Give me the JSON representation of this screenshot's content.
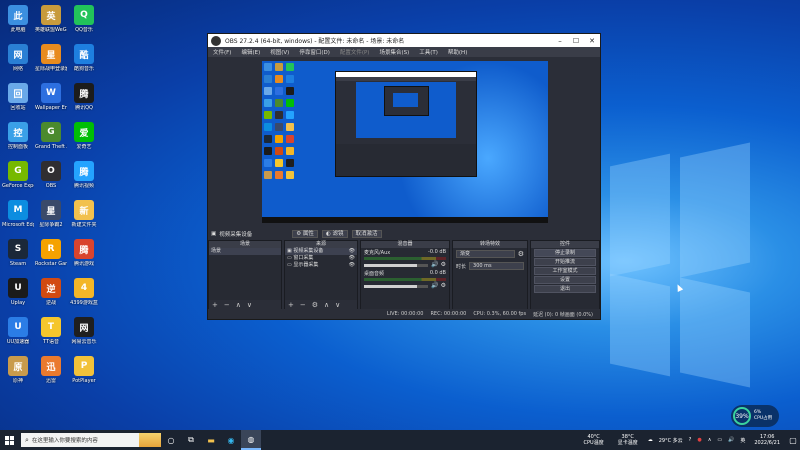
{
  "desktop": {
    "icons": [
      {
        "label": "此电脑",
        "color": "#3b8fe0",
        "icon": "computer-icon"
      },
      {
        "label": "英雄联盟WeGame版",
        "color": "#c89b3c",
        "icon": "game-icon"
      },
      {
        "label": "QQ音乐",
        "color": "#22c35a",
        "icon": "music-icon"
      },
      {
        "label": "网络",
        "color": "#2a7fd4",
        "icon": "network-icon"
      },
      {
        "label": "星际战甲登录器",
        "color": "#e88b1e",
        "icon": "game-icon"
      },
      {
        "label": "酷狗音乐",
        "color": "#1e7fe0",
        "icon": "music-icon"
      },
      {
        "label": "回收站",
        "color": "#6aa9e9",
        "icon": "recycle-bin-icon"
      },
      {
        "label": "Wallpaper Engine",
        "color": "#2d6fe0",
        "icon": "wallpaper-icon"
      },
      {
        "label": "腾讯QQ",
        "color": "#1c1c1c",
        "icon": "qq-icon"
      },
      {
        "label": "控制面板",
        "color": "#3aa0e8",
        "icon": "control-panel-icon"
      },
      {
        "label": "Grand Theft Auto V",
        "color": "#4b8a2e",
        "icon": "game-icon"
      },
      {
        "label": "爱奇艺",
        "color": "#00be06",
        "icon": "video-icon"
      },
      {
        "label": "GeForce Experience",
        "color": "#76b900",
        "icon": "nvidia-icon"
      },
      {
        "label": "OBS",
        "color": "#302e31",
        "icon": "obs-icon"
      },
      {
        "label": "腾讯视频",
        "color": "#24a3ff",
        "icon": "video-icon"
      },
      {
        "label": "Microsoft Edge",
        "color": "#0c8de0",
        "icon": "edge-icon"
      },
      {
        "label": "星际争霸2",
        "color": "#3a4a6a",
        "icon": "game-icon"
      },
      {
        "label": "新建文件夹",
        "color": "#f2c14e",
        "icon": "folder-icon"
      },
      {
        "label": "Steam",
        "color": "#1b2838",
        "icon": "steam-icon"
      },
      {
        "label": "Rockstar Games",
        "color": "#f5a200",
        "icon": "rockstar-icon"
      },
      {
        "label": "腾讯游戏",
        "color": "#d9442e",
        "icon": "game-icon"
      },
      {
        "label": "Uplay",
        "color": "#1b1b1b",
        "icon": "uplay-icon"
      },
      {
        "label": "逆战",
        "color": "#d24a12",
        "icon": "game-icon"
      },
      {
        "label": "4399游戏盒",
        "color": "#f3b628",
        "icon": "game-icon"
      },
      {
        "label": "UU加速器",
        "color": "#2b7de6",
        "icon": "accelerator-icon"
      },
      {
        "label": "TT语音",
        "color": "#f5c62c",
        "icon": "voice-icon"
      },
      {
        "label": "网易云音乐",
        "color": "#1f1f1f",
        "icon": "music-icon"
      },
      {
        "label": "原神",
        "color": "#c99b4c",
        "icon": "game-icon"
      },
      {
        "label": "迅雷",
        "color": "#ea7a2e",
        "icon": "download-icon"
      },
      {
        "label": "PotPlayer",
        "color": "#f2c23a",
        "icon": "player-icon"
      }
    ]
  },
  "obs": {
    "title": "OBS 27.2.4 (64-bit, windows) - 配置文件: 未命名 - 场景: 未命名",
    "menu": [
      "文件(F)",
      "编辑(E)",
      "视图(V)",
      "停靠窗口(D)",
      "配置文件(P)",
      "场景集合(S)",
      "工具(T)",
      "帮助(H)"
    ],
    "source_toolbar": {
      "source_name": "视频采集设备",
      "properties": "属性",
      "filters": "滤镜",
      "deactivate": "取消激活"
    },
    "docks": {
      "scenes": {
        "title": "场景",
        "items": [
          "场景"
        ]
      },
      "sources": {
        "title": "来源",
        "items": [
          "视频采集设备",
          "窗口采集",
          "显示器采集"
        ]
      },
      "mixer": {
        "title": "混音器",
        "items": [
          {
            "name": "麦克风/Aux",
            "db": "-0.0 dB",
            "level": 0.82
          },
          {
            "name": "桌面音频",
            "db": "0.0 dB",
            "level": 0.82
          }
        ]
      },
      "transitions": {
        "title": "转场特效",
        "type": "渐变",
        "duration_label": "时长",
        "duration": "300 ms"
      },
      "controls": {
        "title": "控件",
        "buttons": [
          "停止录制",
          "开始推流",
          "工作室模式",
          "设置",
          "退出"
        ]
      }
    },
    "status": {
      "live": "LIVE: 00:00:00",
      "rec": "REC: 00:00:00",
      "cpu": "CPU: 0.3%, 60.00 fps",
      "warn": "延迟 (0): 0 帧画面 (0.0%)"
    }
  },
  "taskbar": {
    "search_placeholder": "在这里输入你要搜索的内容",
    "temps": [
      {
        "value": "40°C",
        "label": "CPU温度"
      },
      {
        "value": "38°C",
        "label": "显卡温度"
      }
    ],
    "weather": "29°C 多云",
    "time": "17:06",
    "date": "2022/6/21"
  },
  "cpu_widget": {
    "percent": "39%",
    "value": "6%",
    "label": "CPU占用"
  },
  "colors": {
    "obs_bg": "#2b2e38",
    "wallpaper_accent": "#0b5fcf",
    "taskbar": "#1b2330"
  }
}
